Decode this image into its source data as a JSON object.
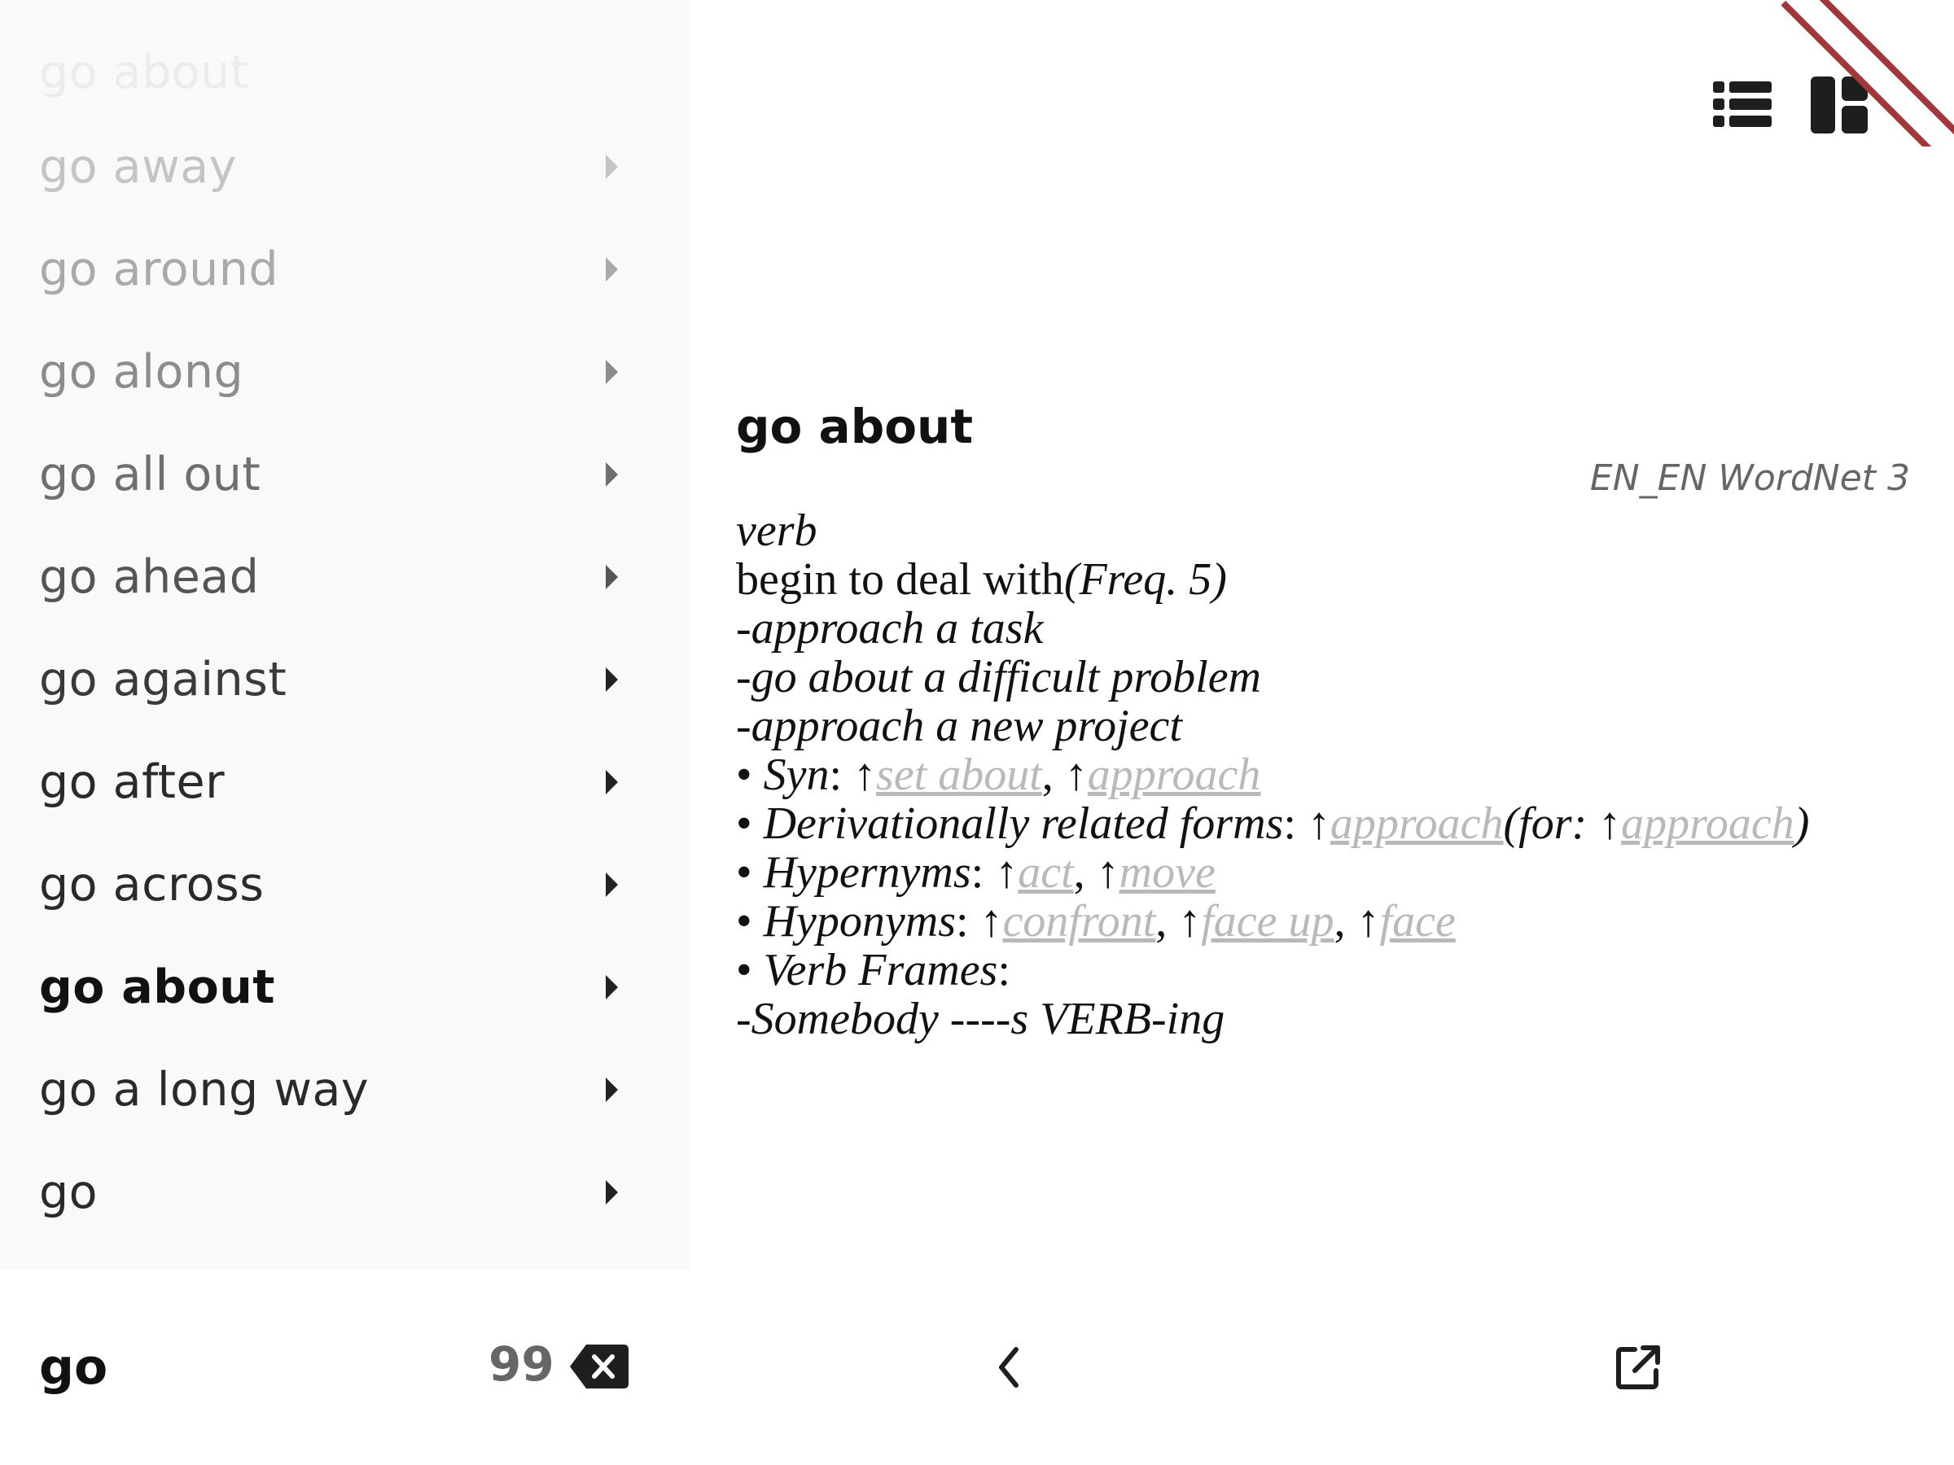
{
  "sidebar": {
    "items": [
      {
        "label": "go about"
      },
      {
        "label": "go away"
      },
      {
        "label": "go around"
      },
      {
        "label": "go along"
      },
      {
        "label": "go all out"
      },
      {
        "label": "go ahead"
      },
      {
        "label": "go against"
      },
      {
        "label": "go after"
      },
      {
        "label": "go across"
      },
      {
        "label": "go about"
      },
      {
        "label": "go a long way"
      },
      {
        "label": "go"
      }
    ],
    "selected_label": "go about"
  },
  "search": {
    "value": "go",
    "count": "99"
  },
  "entry": {
    "title": "go about",
    "source": "EN_EN WordNet 3",
    "pos": "verb",
    "gloss": "begin to deal with",
    "freq": "(Freq. 5)",
    "examples": [
      "-approach a task",
      "-go about a difficult problem",
      "-approach a new project"
    ],
    "syn_label": "Syn",
    "syn": [
      "set about",
      "approach"
    ],
    "deriv_label": "Derivationally related forms",
    "deriv": [
      "approach"
    ],
    "deriv_for_label": "(for: ",
    "deriv_for": [
      "approach"
    ],
    "hyper_label": "Hypernyms",
    "hyper": [
      "act",
      "move"
    ],
    "hypo_label": "Hyponyms",
    "hypo": [
      "confront",
      "face up",
      "face"
    ],
    "frames_label": "Verb Frames",
    "frames": [
      "-Somebody ----s VERB-ing"
    ]
  },
  "colors": {
    "ribbon": "#a3363b",
    "link": "#b9b9b9",
    "sidebar_bg": "#f9f9f9"
  },
  "icons": {
    "list_view": "list-view-icon",
    "dashboard_view": "dashboard-icon",
    "back": "chevron-left-icon",
    "open_external": "open-external-icon",
    "clear": "backspace-icon",
    "row_arrow": "triangle-right-icon"
  }
}
